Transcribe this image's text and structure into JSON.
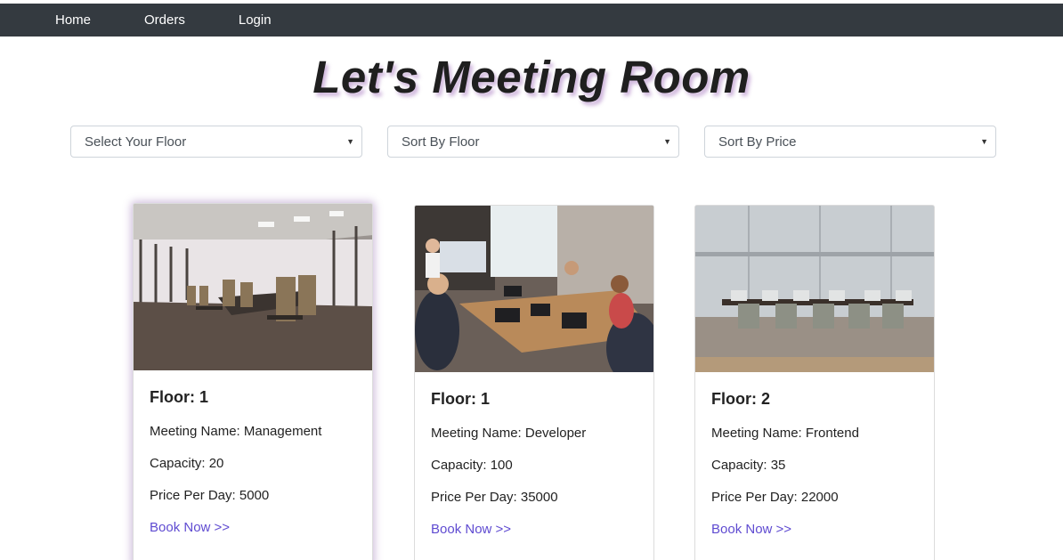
{
  "nav": {
    "items": [
      "Home",
      "Orders",
      "Login"
    ]
  },
  "title": "Let's Meeting Room",
  "filters": {
    "floor": "Select Your Floor",
    "sort_floor": "Sort By Floor",
    "sort_price": "Sort By Price"
  },
  "rooms": [
    {
      "floor": "Floor: 1",
      "meeting_name": "Meeting Name: Management",
      "capacity": "Capacity: 20",
      "price": "Price Per Day: 5000",
      "action": "Book Now >>"
    },
    {
      "floor": "Floor: 1",
      "meeting_name": "Meeting Name: Developer",
      "capacity": "Capacity: 100",
      "price": "Price Per Day: 35000",
      "action": "Book Now >>"
    },
    {
      "floor": "Floor: 2",
      "meeting_name": "Meeting Name: Frontend",
      "capacity": "Capacity: 35",
      "price": "Price Per Day: 22000",
      "action": "Book Now >>"
    }
  ],
  "colors": {
    "navbar": "#343a40",
    "link": "#5f4bd1"
  }
}
